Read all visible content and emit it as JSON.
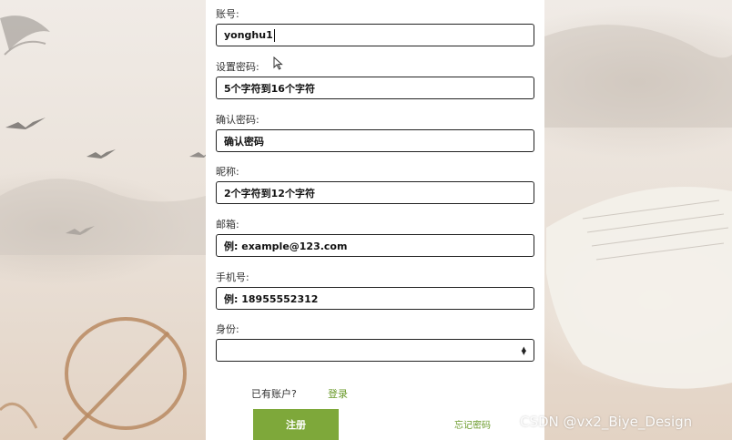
{
  "fields": [
    {
      "label": "账号:",
      "value": "yonghu1",
      "focused": true
    },
    {
      "label": "设置密码:",
      "value": "5个字符到16个字符"
    },
    {
      "label": "确认密码:",
      "value": "确认密码"
    },
    {
      "label": "昵称:",
      "value": "2个字符到12个字符"
    },
    {
      "label": "邮箱:",
      "value": "例: example@123.com"
    },
    {
      "label": "手机号:",
      "value": "例: 18955552312"
    }
  ],
  "identity": {
    "label": "身份:",
    "value": ""
  },
  "links": {
    "have_account": "已有账户?",
    "login": "登录",
    "forgot": "忘记密码"
  },
  "register_button": "注册",
  "watermark": "CSDN @vx2_Biye_Design",
  "colors": {
    "accent_green": "#7ea83a",
    "link_green": "#6a9a2a",
    "panel": "#ffffff"
  }
}
